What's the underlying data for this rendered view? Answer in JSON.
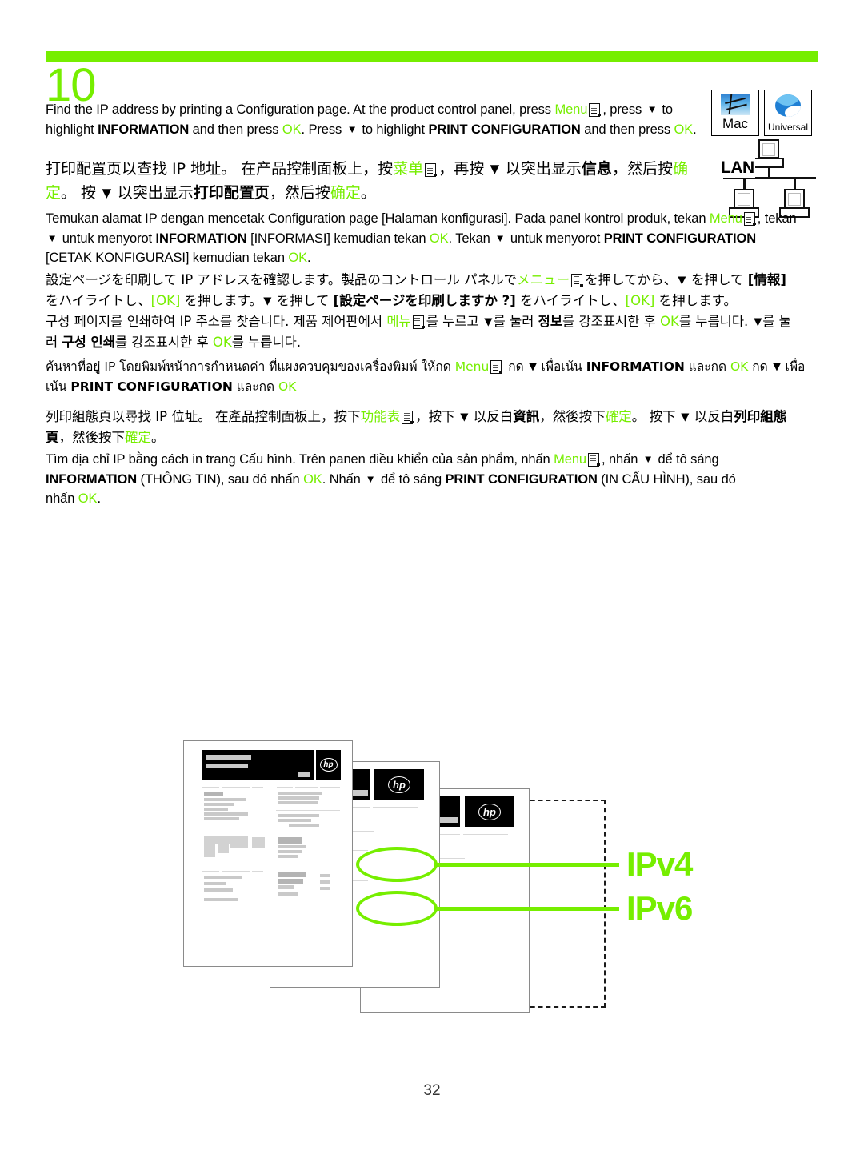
{
  "page": {
    "step_number": "10",
    "page_number": "32",
    "accent_color": "#76EE00",
    "background": "#ffffff"
  },
  "badges": [
    {
      "name": "mac",
      "caption": "Mac"
    },
    {
      "name": "universal",
      "caption": "Universal"
    }
  ],
  "lan": {
    "label": "LAN"
  },
  "instructions": {
    "english": {
      "lang": "English",
      "segments": [
        {
          "t": "Find the IP address by printing a Configuration page. At the product control panel, press "
        },
        {
          "t": "Menu",
          "s": "green"
        },
        {
          "t": "menu-icon",
          "s": "icon"
        },
        {
          "t": ", press "
        },
        {
          "t": "▼",
          "s": "arrow"
        },
        {
          "t": " to highlight "
        },
        {
          "t": "INFORMATION",
          "s": "bold"
        },
        {
          "t": " and then press "
        },
        {
          "t": "OK",
          "s": "green"
        },
        {
          "t": ". Press "
        },
        {
          "t": "▼",
          "s": "arrow"
        },
        {
          "t": " to highlight "
        },
        {
          "t": "PRINT CONFIGURATION",
          "s": "bold"
        },
        {
          "t": " and then press "
        },
        {
          "t": "OK",
          "s": "green"
        },
        {
          "t": "."
        }
      ]
    },
    "simplified_chinese": {
      "lang": "Simplified Chinese",
      "segments": [
        {
          "t": "打印配置页以查找 IP 地址。 在产品控制面板上，按"
        },
        {
          "t": "菜单",
          "s": "green"
        },
        {
          "t": "menu-icon",
          "s": "icon"
        },
        {
          "t": "，再按 "
        },
        {
          "t": "▼",
          "s": "arrow"
        },
        {
          "t": " 以突出显示"
        },
        {
          "t": "信息",
          "s": "bold"
        },
        {
          "t": "，然后按"
        },
        {
          "t": "确定",
          "s": "green"
        },
        {
          "t": "。 按 "
        },
        {
          "t": "▼",
          "s": "arrow"
        },
        {
          "t": " 以突出显示"
        },
        {
          "t": "打印配置页",
          "s": "bold"
        },
        {
          "t": "，然后按"
        },
        {
          "t": "确定",
          "s": "green"
        },
        {
          "t": "。"
        }
      ]
    },
    "indonesian": {
      "lang": "Indonesian",
      "segments": [
        {
          "t": "Temukan alamat IP dengan mencetak Configuration page [Halaman konfigurasi]. Pada panel kontrol produk, tekan "
        },
        {
          "t": "Menu",
          "s": "green"
        },
        {
          "t": "menu-icon",
          "s": "icon"
        },
        {
          "t": ", tekan "
        },
        {
          "t": "▼",
          "s": "arrow"
        },
        {
          "t": " untuk menyorot "
        },
        {
          "t": "INFORMATION",
          "s": "bold"
        },
        {
          "t": " [INFORMASI] kemudian tekan "
        },
        {
          "t": "OK",
          "s": "green"
        },
        {
          "t": ". Tekan "
        },
        {
          "t": "▼",
          "s": "arrow"
        },
        {
          "t": " untuk menyorot "
        },
        {
          "t": "PRINT CONFIGURATION",
          "s": "bold"
        },
        {
          "t": " [CETAK KONFIGURASI] kemudian tekan "
        },
        {
          "t": "OK",
          "s": "green"
        },
        {
          "t": "."
        }
      ]
    },
    "japanese": {
      "lang": "Japanese",
      "segments": [
        {
          "t": "設定ページを印刷して IP アドレスを確認します。製品のコントロール パネルで"
        },
        {
          "t": "メニュー",
          "s": "green"
        },
        {
          "t": "menu-icon",
          "s": "icon"
        },
        {
          "t": "を押してから、"
        },
        {
          "t": "▼",
          "s": "arrow"
        },
        {
          "t": " を押して "
        },
        {
          "t": "[情報]",
          "s": "bold"
        },
        {
          "t": " をハイライトし、"
        },
        {
          "t": "[OK]",
          "s": "green"
        },
        {
          "t": " を押します。"
        },
        {
          "t": "▼",
          "s": "arrow"
        },
        {
          "t": " を押して "
        },
        {
          "t": "[設定ページを印刷しますか ?]",
          "s": "bold"
        },
        {
          "t": " をハイライトし、"
        },
        {
          "t": "[OK]",
          "s": "green"
        },
        {
          "t": " を押します。"
        }
      ]
    },
    "korean": {
      "lang": "Korean",
      "segments": [
        {
          "t": "구성 페이지를 인쇄하여 IP 주소를 찾습니다. 제품 제어판에서 "
        },
        {
          "t": "메뉴",
          "s": "green"
        },
        {
          "t": "menu-icon",
          "s": "icon"
        },
        {
          "t": "를 누르고 "
        },
        {
          "t": "▼",
          "s": "arrow"
        },
        {
          "t": "를 눌러 "
        },
        {
          "t": "정보",
          "s": "bold"
        },
        {
          "t": "를 강조표시한 후 "
        },
        {
          "t": "OK",
          "s": "green"
        },
        {
          "t": "를 누릅니다. "
        },
        {
          "t": "▼",
          "s": "arrow"
        },
        {
          "t": "를 눌러 "
        },
        {
          "t": "구성 인쇄",
          "s": "bold"
        },
        {
          "t": "를 강조표시한 후 "
        },
        {
          "t": "OK",
          "s": "green"
        },
        {
          "t": "를 누릅니다."
        }
      ]
    },
    "thai": {
      "lang": "Thai",
      "segments": [
        {
          "t": "ค้นหาที่อยู่ IP โดยพิมพ์หน้าการกำหนดค่า ที่แผงควบคุมของเครื่องพิมพ์ ให้กด "
        },
        {
          "t": "Menu",
          "s": "green"
        },
        {
          "t": "menu-icon",
          "s": "icon"
        },
        {
          "t": " กด "
        },
        {
          "t": "▼",
          "s": "arrow"
        },
        {
          "t": " เพื่อเน้น "
        },
        {
          "t": "INFORMATION",
          "s": "bold"
        },
        {
          "t": " และกด "
        },
        {
          "t": "OK",
          "s": "green"
        },
        {
          "t": " กด "
        },
        {
          "t": "▼",
          "s": "arrow"
        },
        {
          "t": " เพื่อเน้น "
        },
        {
          "t": "PRINT CONFIGURATION",
          "s": "bold"
        },
        {
          "t": " และกด "
        },
        {
          "t": "OK",
          "s": "green"
        }
      ]
    },
    "traditional_chinese": {
      "lang": "Traditional Chinese",
      "segments": [
        {
          "t": "列印組態頁以尋找 IP 位址。 在產品控制面板上，按下"
        },
        {
          "t": "功能表",
          "s": "green"
        },
        {
          "t": "menu-icon",
          "s": "icon"
        },
        {
          "t": "，按下 "
        },
        {
          "t": "▼",
          "s": "arrow"
        },
        {
          "t": " 以反白"
        },
        {
          "t": "資訊",
          "s": "bold"
        },
        {
          "t": "，然後按下"
        },
        {
          "t": "確定",
          "s": "green"
        },
        {
          "t": "。 按下 "
        },
        {
          "t": "▼",
          "s": "arrow"
        },
        {
          "t": " 以反白"
        },
        {
          "t": "列印組態頁",
          "s": "bold"
        },
        {
          "t": "，然後按下"
        },
        {
          "t": "確定",
          "s": "green"
        },
        {
          "t": "。"
        }
      ]
    },
    "vietnamese": {
      "lang": "Vietnamese",
      "segments": [
        {
          "t": "Tìm địa chỉ IP bằng cách in trang Cấu hình. Trên panen điều khiển của sản phẩm, nhấn "
        },
        {
          "t": "Menu",
          "s": "green"
        },
        {
          "t": "menu-icon",
          "s": "icon"
        },
        {
          "t": ", nhấn "
        },
        {
          "t": "▼",
          "s": "arrow"
        },
        {
          "t": " để tô sáng "
        },
        {
          "t": "INFORMATION",
          "s": "bold"
        },
        {
          "t": " (THÔNG TIN), sau đó nhấn "
        },
        {
          "t": "OK",
          "s": "green"
        },
        {
          "t": ". Nhấn "
        },
        {
          "t": "▼",
          "s": "arrow"
        },
        {
          "t": " để tô sáng "
        },
        {
          "t": "PRINT CONFIGURATION",
          "s": "bold"
        },
        {
          "t": " (IN CẤU HÌNH), sau đó nhấn "
        },
        {
          "t": "OK",
          "s": "green"
        },
        {
          "t": "."
        }
      ]
    }
  },
  "illustration": {
    "callouts": [
      {
        "label": "IPv4"
      },
      {
        "label": "IPv6"
      }
    ],
    "sheets": 3,
    "brand_glyph": "hp"
  }
}
